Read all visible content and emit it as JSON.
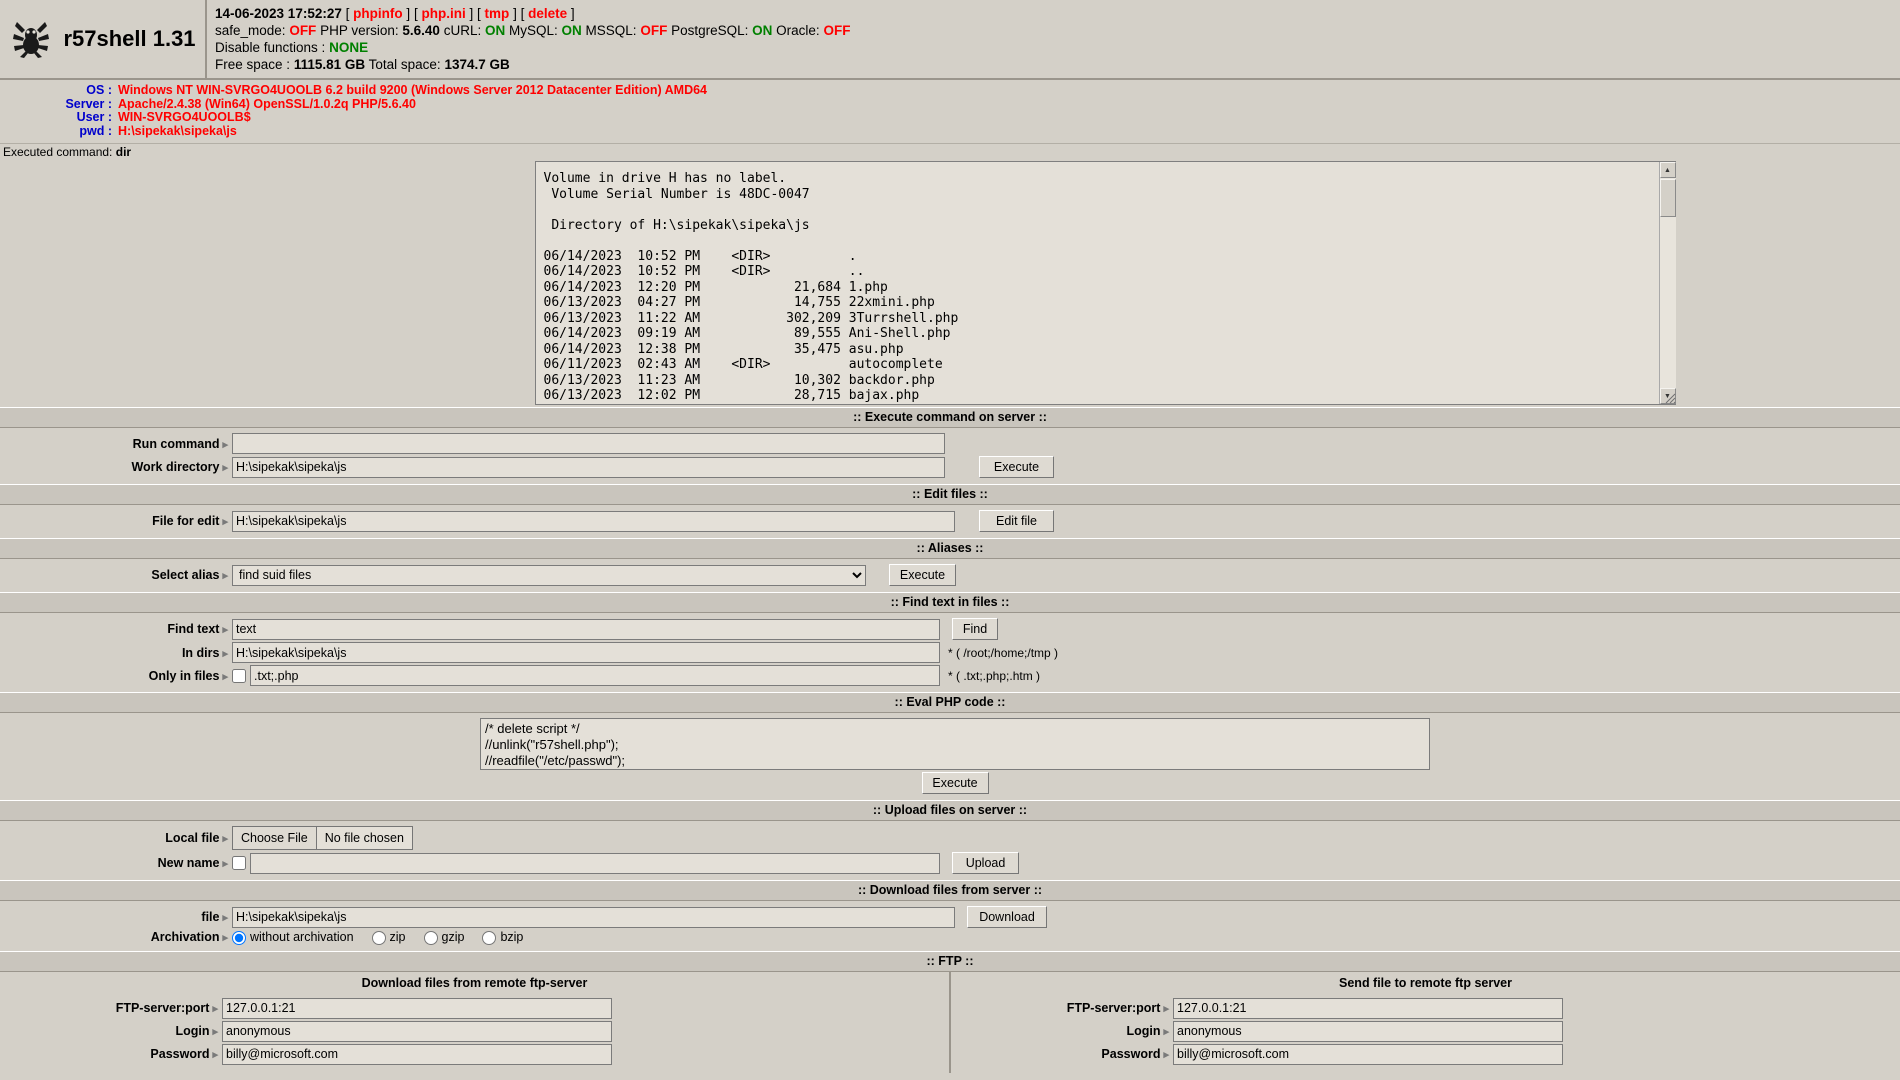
{
  "header": {
    "title": "r57shell 1.31",
    "logo_icon": "spider-icon",
    "datetime": "14-06-2023 17:52:27",
    "links": [
      "phpinfo",
      "php.ini",
      "tmp",
      "delete"
    ],
    "safe_mode_label": "safe_mode:",
    "safe_mode_value": "OFF",
    "php_version_label": "PHP version:",
    "php_version_value": "5.6.40",
    "curl_label": "cURL:",
    "curl_value": "ON",
    "mysql_label": "MySQL:",
    "mysql_value": "ON",
    "mssql_label": "MSSQL:",
    "mssql_value": "OFF",
    "postgresql_label": "PostgreSQL:",
    "postgresql_value": "ON",
    "oracle_label": "Oracle:",
    "oracle_value": "OFF",
    "disable_functions_label": "Disable functions :",
    "disable_functions_value": "NONE",
    "free_space_label": "Free space :",
    "free_space_value": "1115.81 GB",
    "total_space_label": "Total space:",
    "total_space_value": "1374.7 GB"
  },
  "server_info": [
    {
      "label": "OS :",
      "value": "Windows NT WIN-SVRGO4UOOLB 6.2 build 9200 (Windows Server 2012 Datacenter Edition) AMD64"
    },
    {
      "label": "Server :",
      "value": "Apache/2.4.38 (Win64) OpenSSL/1.0.2q PHP/5.6.40"
    },
    {
      "label": "User :",
      "value": "WIN-SVRGO4UOOLB$"
    },
    {
      "label": "pwd :",
      "value": "H:\\sipekak\\sipeka\\js"
    }
  ],
  "executed": {
    "label": "Executed command:",
    "command": "dir"
  },
  "output": {
    "text": "Volume in drive H has no label.\n Volume Serial Number is 48DC-0047\n\n Directory of H:\\sipekak\\sipeka\\js\n\n06/14/2023  10:52 PM    <DIR>          .\n06/14/2023  10:52 PM    <DIR>          ..\n06/14/2023  12:20 PM            21,684 1.php\n06/13/2023  04:27 PM            14,755 22xmini.php\n06/13/2023  11:22 AM           302,209 3Turrshell.php\n06/14/2023  09:19 AM            89,555 Ani-Shell.php\n06/14/2023  12:38 PM            35,475 asu.php\n06/11/2023  02:43 AM    <DIR>          autocomplete\n06/13/2023  11:23 AM            10,302 backdor.php\n06/13/2023  12:02 PM            28,715 bajax.php"
  },
  "sections": {
    "execute_command": ":: Execute command on server ::",
    "edit_files": ":: Edit files ::",
    "aliases": ":: Aliases ::",
    "find_text": ":: Find text in files ::",
    "eval_php": ":: Eval PHP code ::",
    "upload_files": ":: Upload files on server ::",
    "download_files": ":: Download files from server ::",
    "ftp": ":: FTP ::"
  },
  "execute_command": {
    "run_command_label": "Run command",
    "run_command_value": "",
    "work_directory_label": "Work directory",
    "work_directory_value": "H:\\sipekak\\sipeka\\js",
    "execute_button": "Execute"
  },
  "edit_files": {
    "file_for_edit_label": "File for edit",
    "file_for_edit_value": "H:\\sipekak\\sipeka\\js",
    "edit_file_button": "Edit file"
  },
  "aliases": {
    "select_alias_label": "Select alias",
    "selected_option": "find suid files",
    "options": [
      "find suid files"
    ],
    "execute_button": "Execute"
  },
  "find_text": {
    "find_text_label": "Find text",
    "find_text_value": "text",
    "find_button": "Find",
    "in_dirs_label": "In dirs",
    "in_dirs_value": "H:\\sipekak\\sipeka\\js",
    "in_dirs_hint": "* ( /root;/home;/tmp )",
    "only_in_files_label": "Only in files",
    "only_in_files_value": ".txt;.php",
    "only_in_files_checked": false,
    "only_in_files_hint": "* ( .txt;.php;.htm )"
  },
  "eval_php": {
    "code": "/* delete script */\n//unlink(\"r57shell.php\");\n//readfile(\"/etc/passwd\");",
    "execute_button": "Execute"
  },
  "upload": {
    "local_file_label": "Local file",
    "choose_file_button": "Choose File",
    "no_file_text": "No file chosen",
    "new_name_label": "New name",
    "new_name_value": "",
    "new_name_checked": false,
    "upload_button": "Upload"
  },
  "download": {
    "file_label": "file",
    "file_value": "H:\\sipekak\\sipeka\\js",
    "download_button": "Download",
    "archivation_label": "Archivation",
    "options": [
      {
        "label": "without archivation",
        "checked": true
      },
      {
        "label": "zip",
        "checked": false
      },
      {
        "label": "gzip",
        "checked": false
      },
      {
        "label": "bzip",
        "checked": false
      }
    ]
  },
  "ftp": {
    "left_title": "Download files from remote ftp-server",
    "right_title": "Send file to remote ftp server",
    "server_port_label": "FTP-server:port",
    "server_port_value": "127.0.0.1:21",
    "login_label": "Login",
    "login_value": "anonymous",
    "password_label": "Password",
    "password_value": "billy@microsoft.com"
  }
}
